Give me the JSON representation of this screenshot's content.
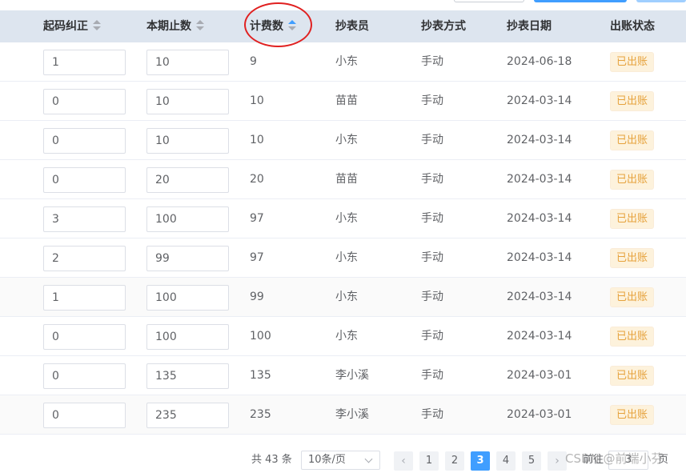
{
  "headers": {
    "correction": "起码纠正",
    "current_reading": "本期止数",
    "billing_count": "计费数",
    "reader": "抄表员",
    "method": "抄表方式",
    "date": "抄表日期",
    "status": "出账状态"
  },
  "rows": [
    {
      "correction": "1",
      "current_reading": "10",
      "billing_count": "9",
      "reader": "小东",
      "method": "手动",
      "date": "2024-06-18",
      "status": "已出账"
    },
    {
      "correction": "0",
      "current_reading": "10",
      "billing_count": "10",
      "reader": "苗苗",
      "method": "手动",
      "date": "2024-03-14",
      "status": "已出账"
    },
    {
      "correction": "0",
      "current_reading": "10",
      "billing_count": "10",
      "reader": "小东",
      "method": "手动",
      "date": "2024-03-14",
      "status": "已出账"
    },
    {
      "correction": "0",
      "current_reading": "20",
      "billing_count": "20",
      "reader": "苗苗",
      "method": "手动",
      "date": "2024-03-14",
      "status": "已出账"
    },
    {
      "correction": "3",
      "current_reading": "100",
      "billing_count": "97",
      "reader": "小东",
      "method": "手动",
      "date": "2024-03-14",
      "status": "已出账"
    },
    {
      "correction": "2",
      "current_reading": "99",
      "billing_count": "97",
      "reader": "小东",
      "method": "手动",
      "date": "2024-03-14",
      "status": "已出账"
    },
    {
      "correction": "1",
      "current_reading": "100",
      "billing_count": "99",
      "reader": "小东",
      "method": "手动",
      "date": "2024-03-14",
      "status": "已出账"
    },
    {
      "correction": "0",
      "current_reading": "100",
      "billing_count": "100",
      "reader": "小东",
      "method": "手动",
      "date": "2024-03-14",
      "status": "已出账"
    },
    {
      "correction": "0",
      "current_reading": "135",
      "billing_count": "135",
      "reader": "李小溪",
      "method": "手动",
      "date": "2024-03-01",
      "status": "已出账"
    },
    {
      "correction": "0",
      "current_reading": "235",
      "billing_count": "235",
      "reader": "李小溪",
      "method": "手动",
      "date": "2024-03-01",
      "status": "已出账"
    }
  ],
  "sort": {
    "column": "billing_count",
    "direction": "ascending"
  },
  "pagination": {
    "total_label": "共 43 条",
    "page_size": "10条/页",
    "prev": "‹",
    "next": "›",
    "pages": [
      "1",
      "2",
      "3",
      "4",
      "5"
    ],
    "current_page": "3",
    "goto_label": "前往",
    "goto_value": "3",
    "page_suffix": "页"
  },
  "watermark": "CSDN @前端小芬",
  "colors": {
    "header_bg": "#dde5ef",
    "primary": "#409eff",
    "badge_bg": "#fdf2dc",
    "badge_text": "#e6a23c",
    "annotation_circle": "#e02020"
  }
}
